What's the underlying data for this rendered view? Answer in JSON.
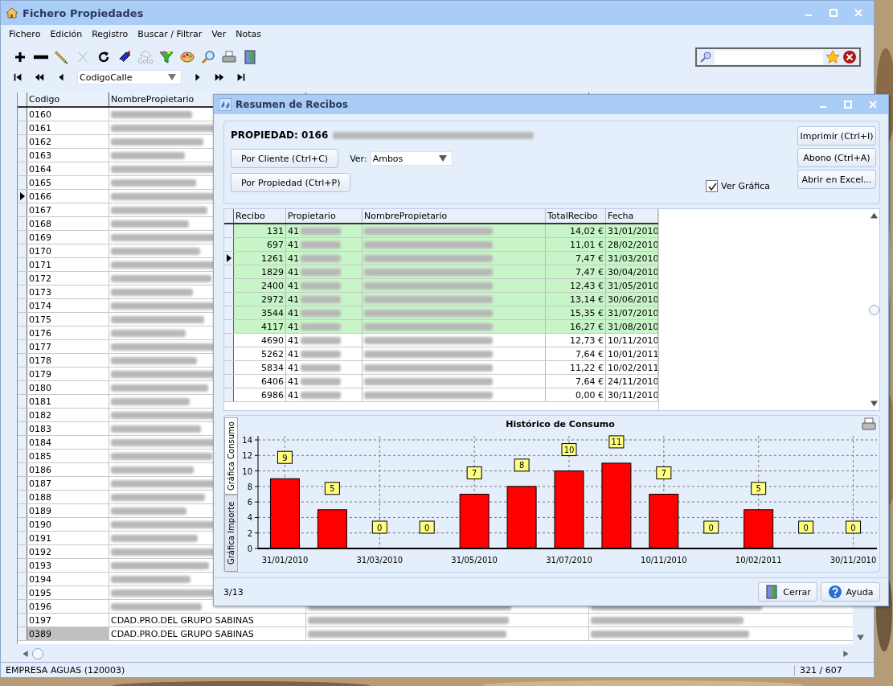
{
  "window": {
    "title": "Fichero Propiedades"
  },
  "menu": [
    "Fichero",
    "Edición",
    "Registro",
    "Buscar / Filtrar",
    "Ver",
    "Notas"
  ],
  "toolbar": [
    {
      "kind": "add",
      "disabled": false
    },
    {
      "kind": "remove",
      "disabled": false
    },
    {
      "kind": "edit",
      "disabled": false
    },
    {
      "kind": "cut",
      "disabled": true
    },
    {
      "kind": "refresh",
      "disabled": false
    },
    {
      "kind": "book",
      "disabled": false
    },
    {
      "kind": "goto",
      "label": "Goto",
      "disabled": true
    },
    {
      "kind": "filter",
      "disabled": false
    },
    {
      "kind": "palette",
      "disabled": false
    },
    {
      "kind": "zoom",
      "disabled": false
    },
    {
      "kind": "print",
      "disabled": false
    },
    {
      "kind": "exit",
      "disabled": false
    }
  ],
  "navigator": {
    "buttons_before": [
      {
        "kind": "first"
      },
      {
        "kind": "prev-page"
      },
      {
        "kind": "prev"
      }
    ],
    "field": "CodigoCalle",
    "buttons_after": [
      {
        "kind": "next"
      },
      {
        "kind": "next-page"
      },
      {
        "kind": "last"
      }
    ]
  },
  "table": {
    "columns": [
      "Codigo",
      "NombrePropietario"
    ],
    "rows": [
      {
        "code": "0160",
        "selected": false
      },
      {
        "code": "0161",
        "selected": false
      },
      {
        "code": "0162",
        "selected": false
      },
      {
        "code": "0163",
        "selected": false
      },
      {
        "code": "0164",
        "selected": false
      },
      {
        "code": "0165",
        "selected": false
      },
      {
        "code": "0166",
        "selected": true
      },
      {
        "code": "0167",
        "selected": false
      },
      {
        "code": "0168",
        "selected": false
      },
      {
        "code": "0169",
        "selected": false
      },
      {
        "code": "0170",
        "selected": false
      },
      {
        "code": "0171",
        "selected": false
      },
      {
        "code": "0172",
        "selected": false
      },
      {
        "code": "0173",
        "selected": false
      },
      {
        "code": "0174",
        "selected": false
      },
      {
        "code": "0175",
        "selected": false
      },
      {
        "code": "0176",
        "selected": false
      },
      {
        "code": "0177",
        "selected": false
      },
      {
        "code": "0178",
        "selected": false
      },
      {
        "code": "0179",
        "selected": false
      },
      {
        "code": "0180",
        "selected": false
      },
      {
        "code": "0181",
        "selected": false
      },
      {
        "code": "0182",
        "selected": false
      },
      {
        "code": "0183",
        "selected": false
      },
      {
        "code": "0184",
        "selected": false
      },
      {
        "code": "0185",
        "selected": false
      },
      {
        "code": "0186",
        "selected": false
      },
      {
        "code": "0187",
        "selected": false
      },
      {
        "code": "0188",
        "selected": false
      },
      {
        "code": "0189",
        "selected": false
      },
      {
        "code": "0190",
        "selected": false
      },
      {
        "code": "0191",
        "selected": false
      },
      {
        "code": "0192",
        "selected": false
      },
      {
        "code": "0193",
        "selected": false
      },
      {
        "code": "0194",
        "selected": false
      },
      {
        "code": "0195",
        "selected": false
      },
      {
        "code": "0196",
        "selected": false
      },
      {
        "code": "0197",
        "name": "CDAD.PRO.DEL GRUPO SABINAS",
        "selected": false
      },
      {
        "code": "0389",
        "name": "CDAD.PRO.DEL GRUPO SABINAS",
        "selected": false,
        "focused": true
      }
    ]
  },
  "status_bar": {
    "left": "EMPRESA AGUAS (120003)",
    "right": "321 / 607"
  },
  "dialog": {
    "title": "Resumen de Recibos",
    "property_label": "PROPIEDAD: 0166",
    "buttons_left": [
      "Por Cliente (Ctrl+C)",
      "Por Propiedad (Ctrl+P)"
    ],
    "ver": {
      "label": "Ver:",
      "value": "Ambos"
    },
    "ver_grafica": {
      "label": "Ver Gráfica",
      "checked": true
    },
    "buttons_right": [
      "Imprimir (Ctrl+I)",
      "Abono (Ctrl+A)",
      "Abrir en Excel..."
    ],
    "grid": {
      "columns": [
        "Recibo",
        "Propietario",
        "NombrePropietario",
        "TotalRecibo",
        "Fecha"
      ],
      "rows": [
        {
          "recibo": "131",
          "propietario": "41",
          "total": "14,02 €",
          "fecha": "31/01/2010",
          "highlight": true,
          "selected": false
        },
        {
          "recibo": "697",
          "propietario": "41",
          "total": "11,01 €",
          "fecha": "28/02/2010",
          "highlight": true,
          "selected": false
        },
        {
          "recibo": "1261",
          "propietario": "41",
          "total": "7,47 €",
          "fecha": "31/03/2010",
          "highlight": true,
          "selected": true
        },
        {
          "recibo": "1829",
          "propietario": "41",
          "total": "7,47 €",
          "fecha": "30/04/2010",
          "highlight": true,
          "selected": false
        },
        {
          "recibo": "2400",
          "propietario": "41",
          "total": "12,43 €",
          "fecha": "31/05/2010",
          "highlight": true,
          "selected": false
        },
        {
          "recibo": "2972",
          "propietario": "41",
          "total": "13,14 €",
          "fecha": "30/06/2010",
          "highlight": true,
          "selected": false
        },
        {
          "recibo": "3544",
          "propietario": "41",
          "total": "15,35 €",
          "fecha": "31/07/2010",
          "highlight": true,
          "selected": false
        },
        {
          "recibo": "4117",
          "propietario": "41",
          "total": "16,27 €",
          "fecha": "31/08/2010",
          "highlight": true,
          "selected": false
        },
        {
          "recibo": "4690",
          "propietario": "41",
          "total": "12,73 €",
          "fecha": "10/11/2010",
          "highlight": false,
          "selected": false
        },
        {
          "recibo": "5262",
          "propietario": "41",
          "total": "7,64 €",
          "fecha": "10/01/2011",
          "highlight": false,
          "selected": false
        },
        {
          "recibo": "5834",
          "propietario": "41",
          "total": "11,22 €",
          "fecha": "10/02/2011",
          "highlight": false,
          "selected": false
        },
        {
          "recibo": "6406",
          "propietario": "41",
          "total": "7,64 €",
          "fecha": "24/11/2010",
          "highlight": false,
          "selected": false
        },
        {
          "recibo": "6986",
          "propietario": "41",
          "total": "0,00 €",
          "fecha": "30/11/2010",
          "highlight": false,
          "selected": false
        }
      ]
    },
    "chart_tabs": [
      {
        "label": "Gráfica Consumo",
        "selected": true
      },
      {
        "label": "Gráfica Importe",
        "selected": false
      }
    ],
    "chart_data": {
      "type": "bar",
      "title": "Histórico de Consumo",
      "categories": [
        "31/01/2010",
        null,
        "31/03/2010",
        null,
        "31/05/2010",
        null,
        "31/07/2010",
        null,
        "10/11/2010",
        null,
        "10/02/2011",
        null,
        "30/11/2010"
      ],
      "series": [
        {
          "color": "#ff0000",
          "values": [
            9,
            5,
            0,
            0,
            7,
            8,
            10,
            11,
            7,
            0,
            5,
            0,
            0
          ]
        }
      ],
      "ylim": [
        0,
        14
      ],
      "yticks": [
        0,
        2,
        4,
        6,
        8,
        10,
        12,
        14
      ],
      "grid": true,
      "data_labels": true
    },
    "position": "3/13",
    "footer_buttons": [
      {
        "kind": "close",
        "label": "Cerrar"
      },
      {
        "kind": "help",
        "label": "Ayuda"
      }
    ]
  }
}
